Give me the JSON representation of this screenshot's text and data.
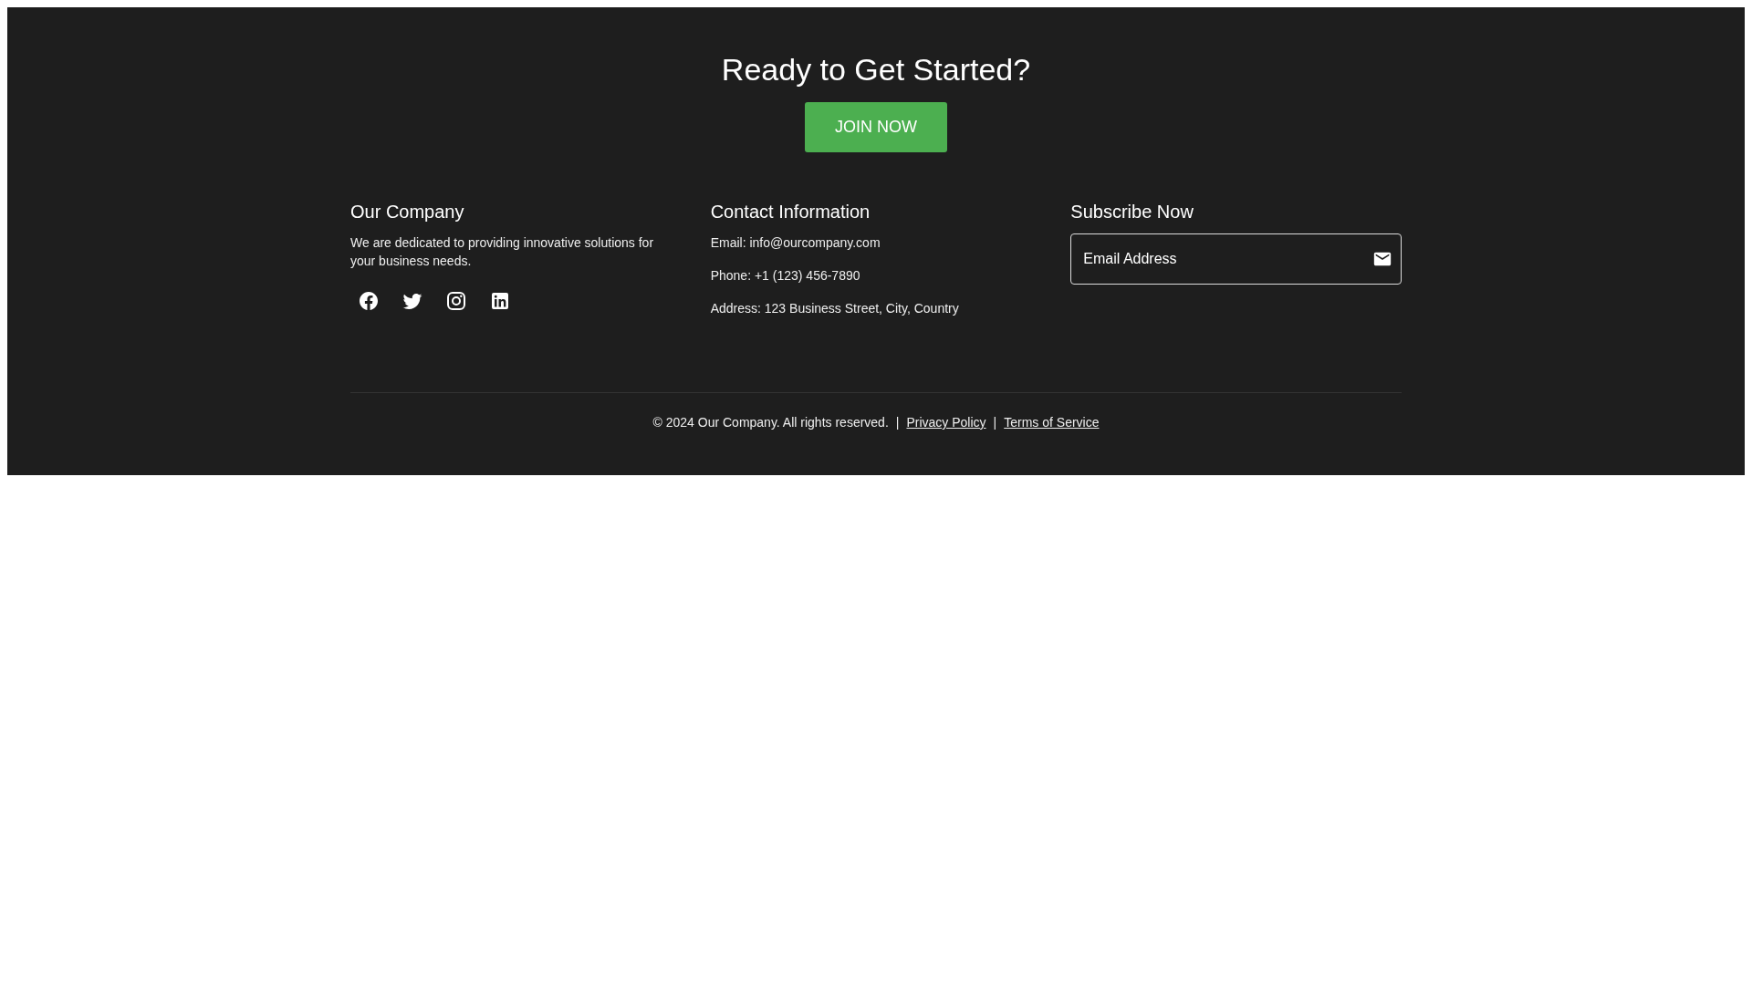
{
  "cta": {
    "title": "Ready to Get Started?",
    "button": "JOIN NOW"
  },
  "company": {
    "heading": "Our Company",
    "text": "We are dedicated to providing innovative solutions for your business needs.",
    "social": [
      {
        "kind": "facebook"
      },
      {
        "kind": "twitter"
      },
      {
        "kind": "instagram"
      },
      {
        "kind": "linkedin"
      }
    ]
  },
  "contact": {
    "heading": "Contact Information",
    "lines": [
      "Email: info@ourcompany.com",
      "Phone: +1 (123) 456-7890",
      "Address: 123 Business Street, City, Country"
    ]
  },
  "subscribe": {
    "heading": "Subscribe Now",
    "placeholder": "Email Address"
  },
  "bottom": {
    "copyright": "© 2024 Our Company. All rights reserved.",
    "separator": "|",
    "links": [
      "Privacy Policy",
      "Terms of Service"
    ]
  }
}
